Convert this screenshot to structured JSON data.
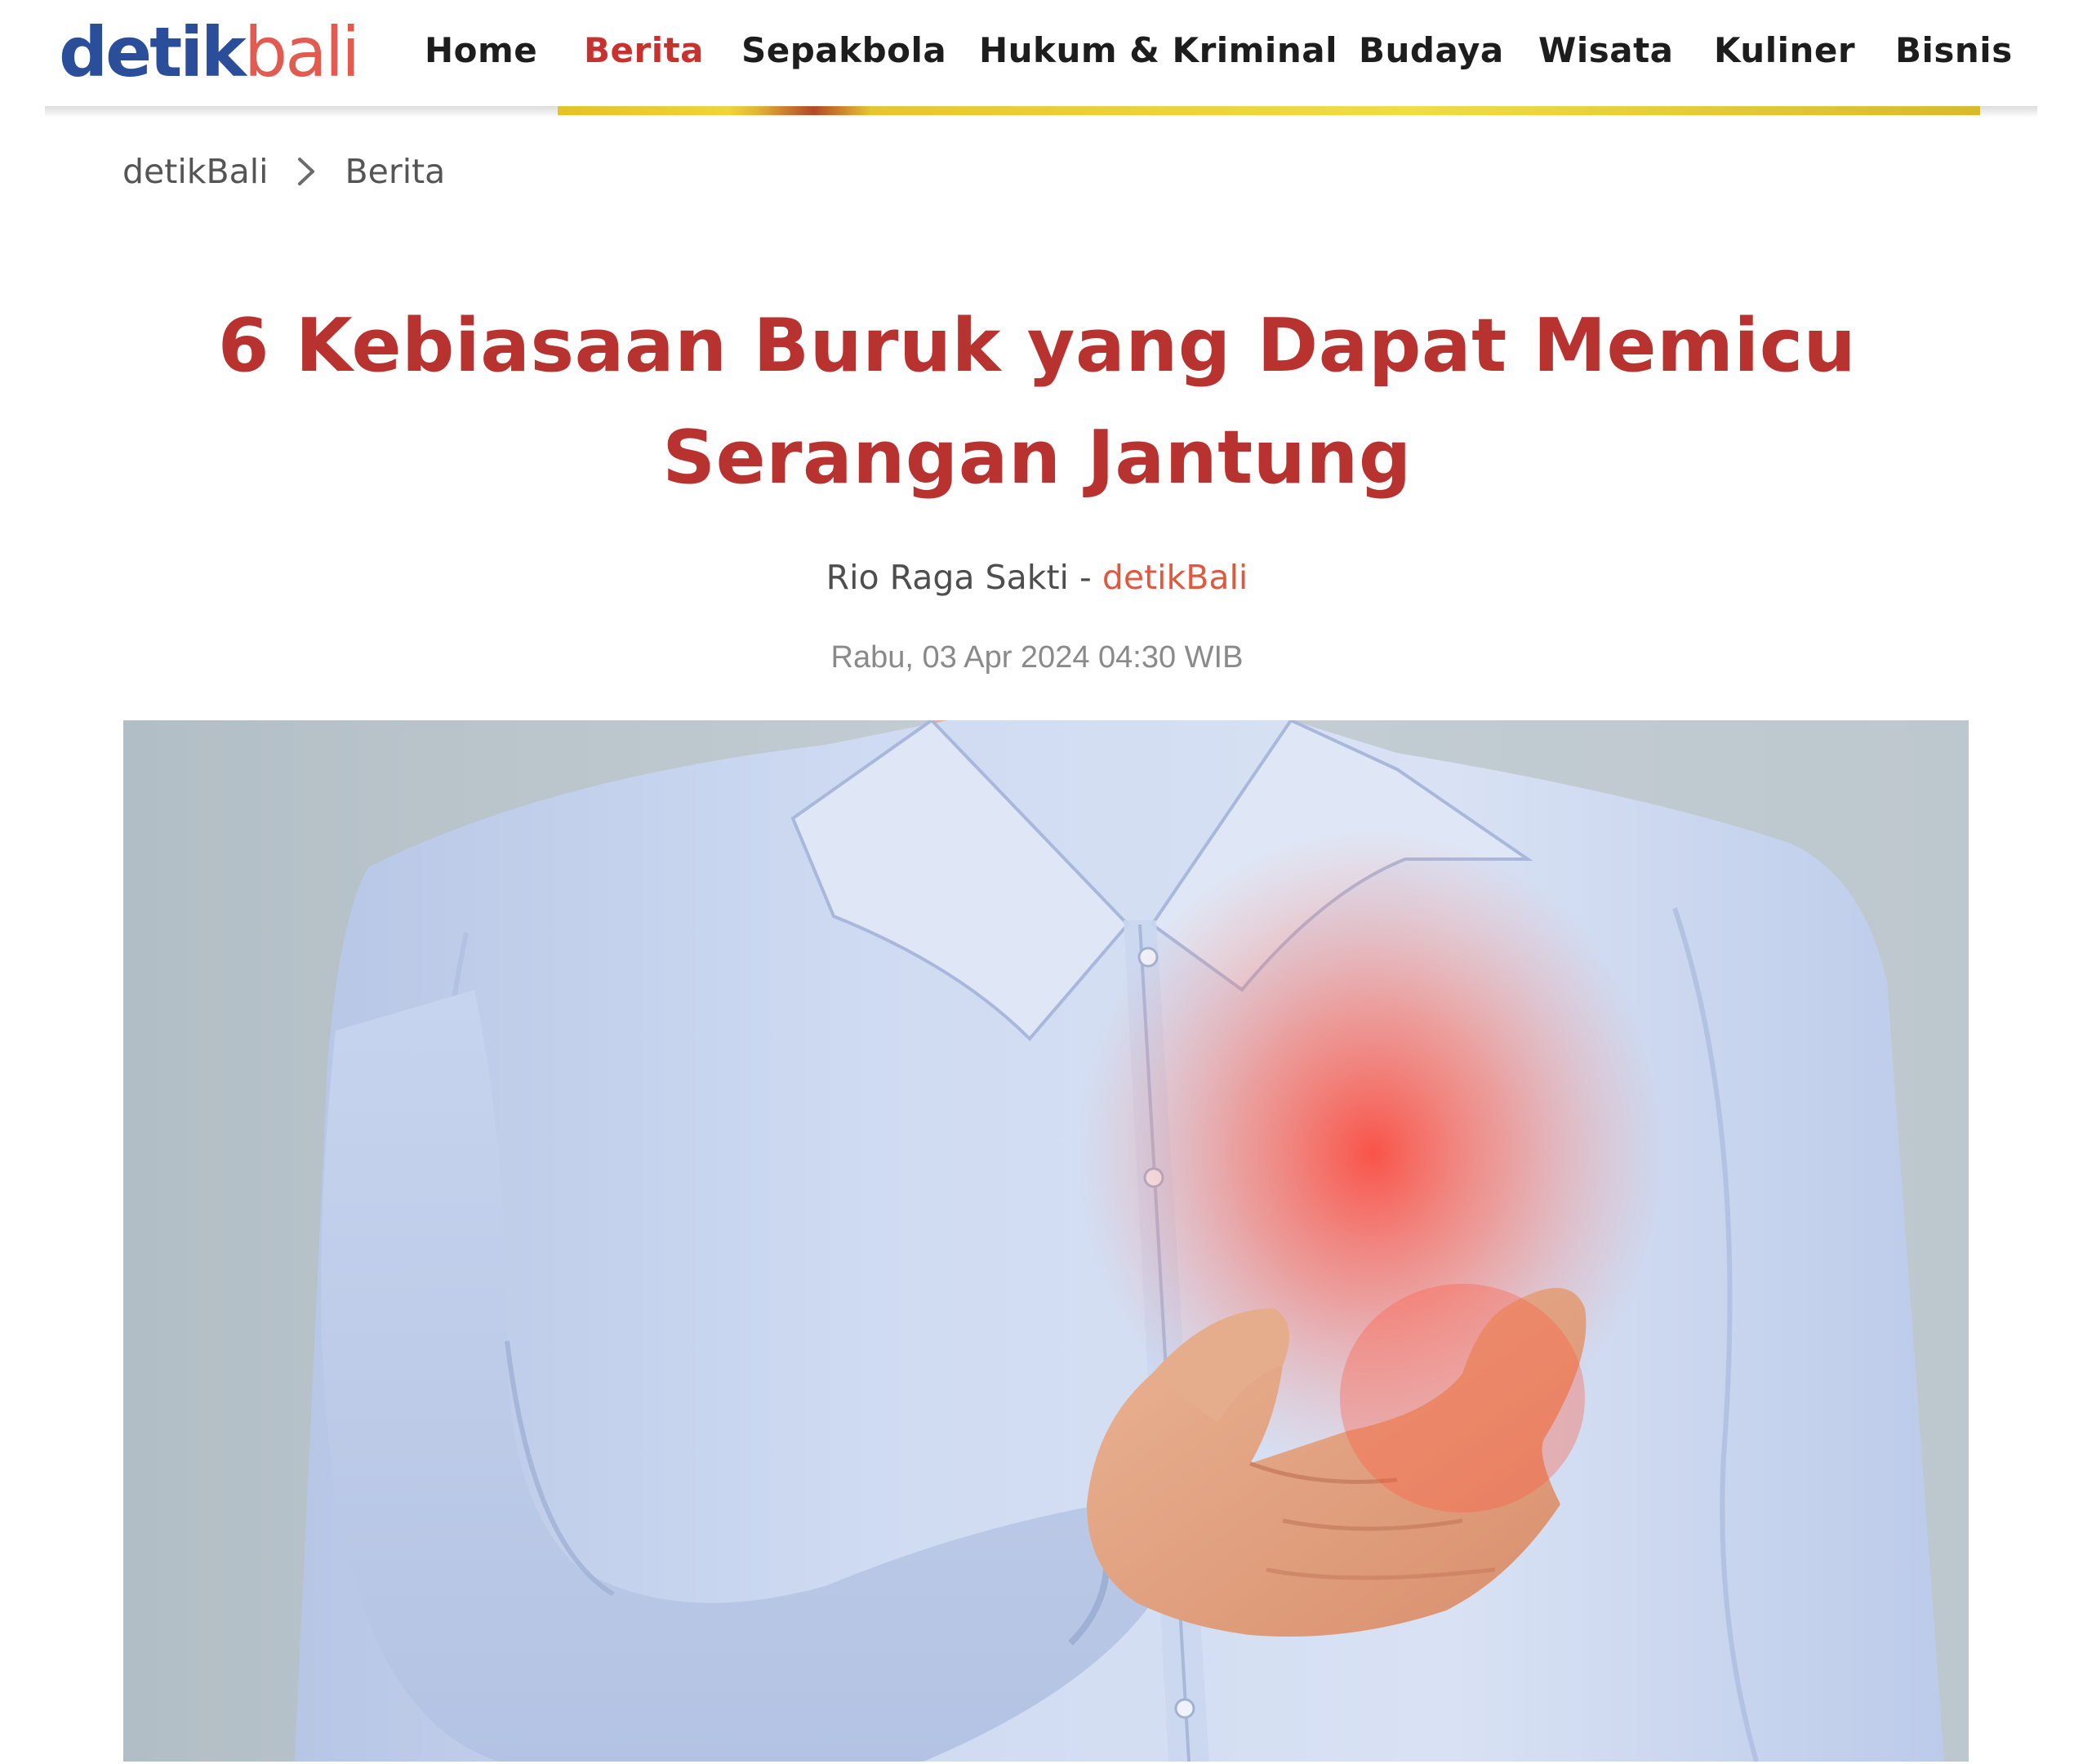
{
  "header": {
    "logo": {
      "part1": "detik",
      "part2": "bali"
    },
    "nav": [
      {
        "label": "Home",
        "active": false
      },
      {
        "label": "Berita",
        "active": true
      },
      {
        "label": "Sepakbola",
        "active": false
      },
      {
        "label": "Hukum & Kriminal",
        "active": false
      },
      {
        "label": "Budaya",
        "active": false
      },
      {
        "label": "Wisata",
        "active": false
      },
      {
        "label": "Kuliner",
        "active": false
      },
      {
        "label": "Bisnis",
        "active": false
      }
    ]
  },
  "breadcrumb": {
    "items": [
      "detikBali",
      "Berita"
    ],
    "separator_icon": "chevron-right-icon"
  },
  "article": {
    "title_line1": "6 Kebiasaan Buruk yang Dapat Memicu",
    "title_line2": "Serangan Jantung",
    "author": "Rio Raga Sakti",
    "byline_separator": "-",
    "source": "detikBali",
    "date": "Rabu, 03 Apr 2024 04:30 WIB"
  },
  "colors": {
    "brand_blue": "#2a4e9a",
    "brand_coral": "#e25a50",
    "title_red": "#b8322f",
    "active_nav": "#c8322e",
    "source_orange": "#e0593f"
  }
}
